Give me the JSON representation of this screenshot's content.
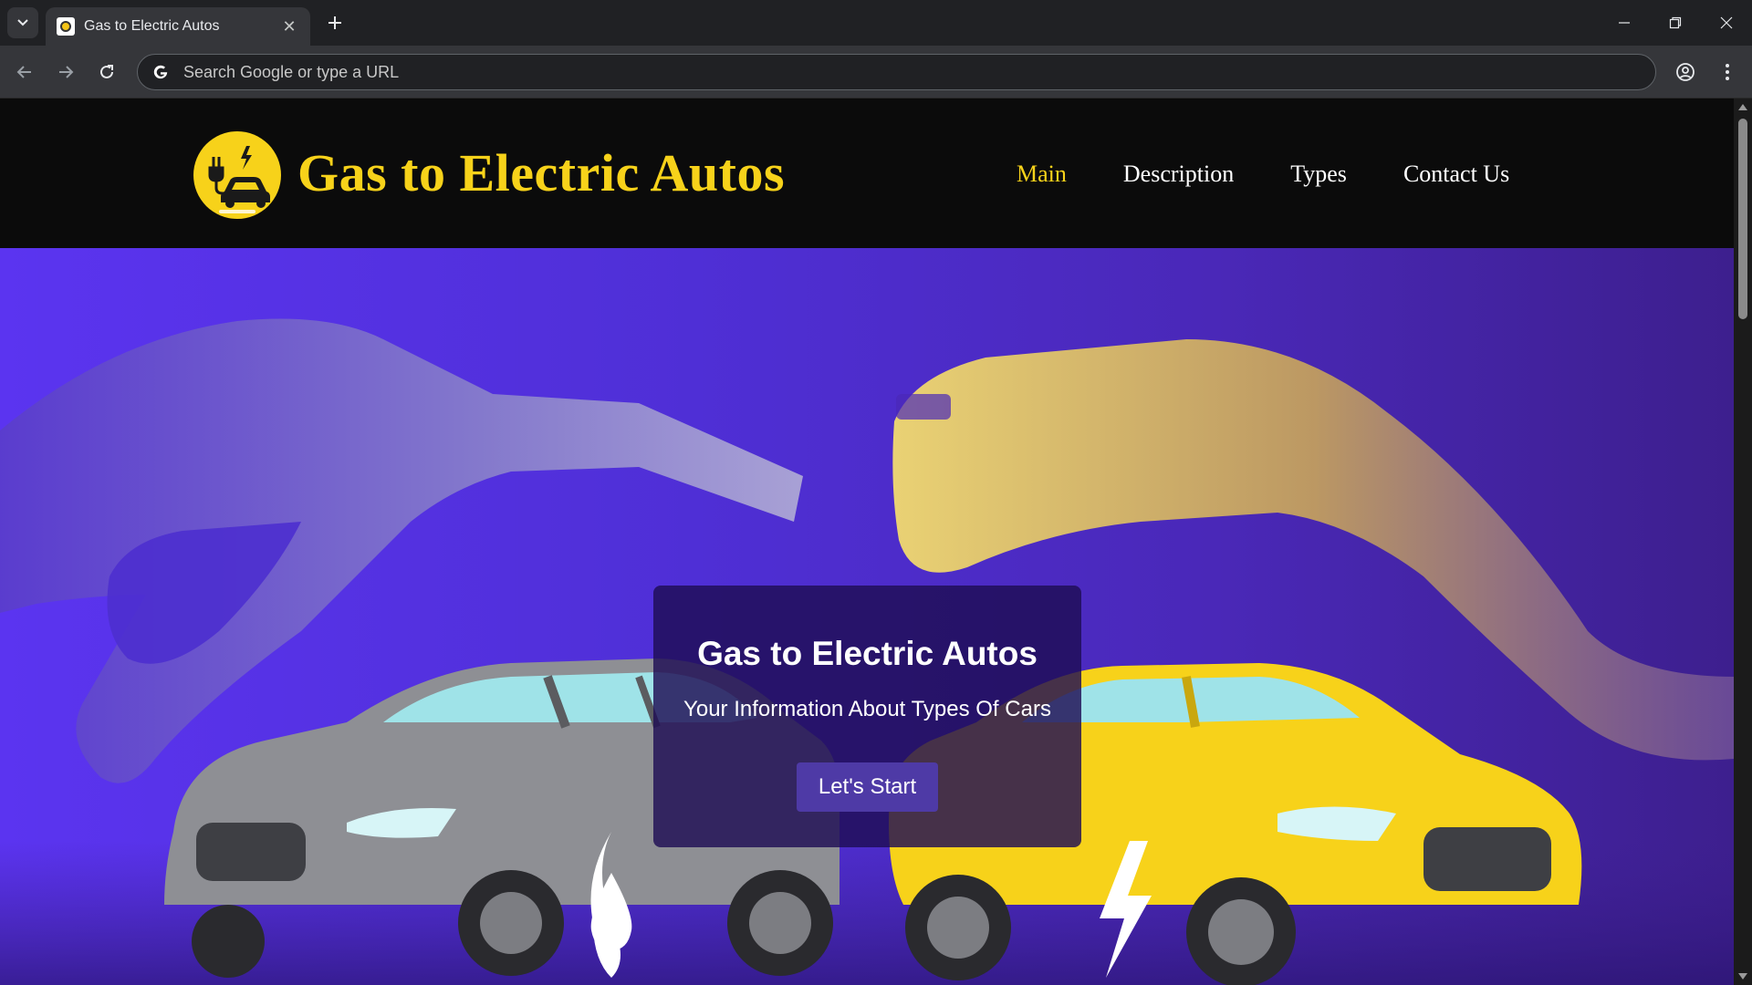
{
  "browser": {
    "tab_title": "Gas to Electric Autos",
    "omnibox_placeholder": "Search Google or type a URL"
  },
  "site": {
    "brand": "Gas to Electric Autos",
    "nav": [
      {
        "label": "Main",
        "active": true
      },
      {
        "label": "Description",
        "active": false
      },
      {
        "label": "Types",
        "active": false
      },
      {
        "label": "Contact Us",
        "active": false
      }
    ]
  },
  "hero": {
    "title": "Gas to Electric Autos",
    "subtitle": "Your Information About Types Of Cars",
    "button_label": "Let's Start"
  },
  "colors": {
    "brand_yellow": "#f7d21a",
    "hero_purple": "#5b34f0",
    "card_bg": "#1e0e54",
    "button_bg": "#4e3aa6"
  },
  "icons": [
    "tab-search-icon",
    "favicon-icon",
    "close-icon",
    "plus-icon",
    "minimize-icon",
    "restore-icon",
    "window-close-icon",
    "back-arrow-icon",
    "forward-arrow-icon",
    "reload-icon",
    "google-icon",
    "profile-icon",
    "menu-dots-icon",
    "logo-car-plug-icon",
    "fuel-drop-icon",
    "lightning-bolt-icon"
  ]
}
